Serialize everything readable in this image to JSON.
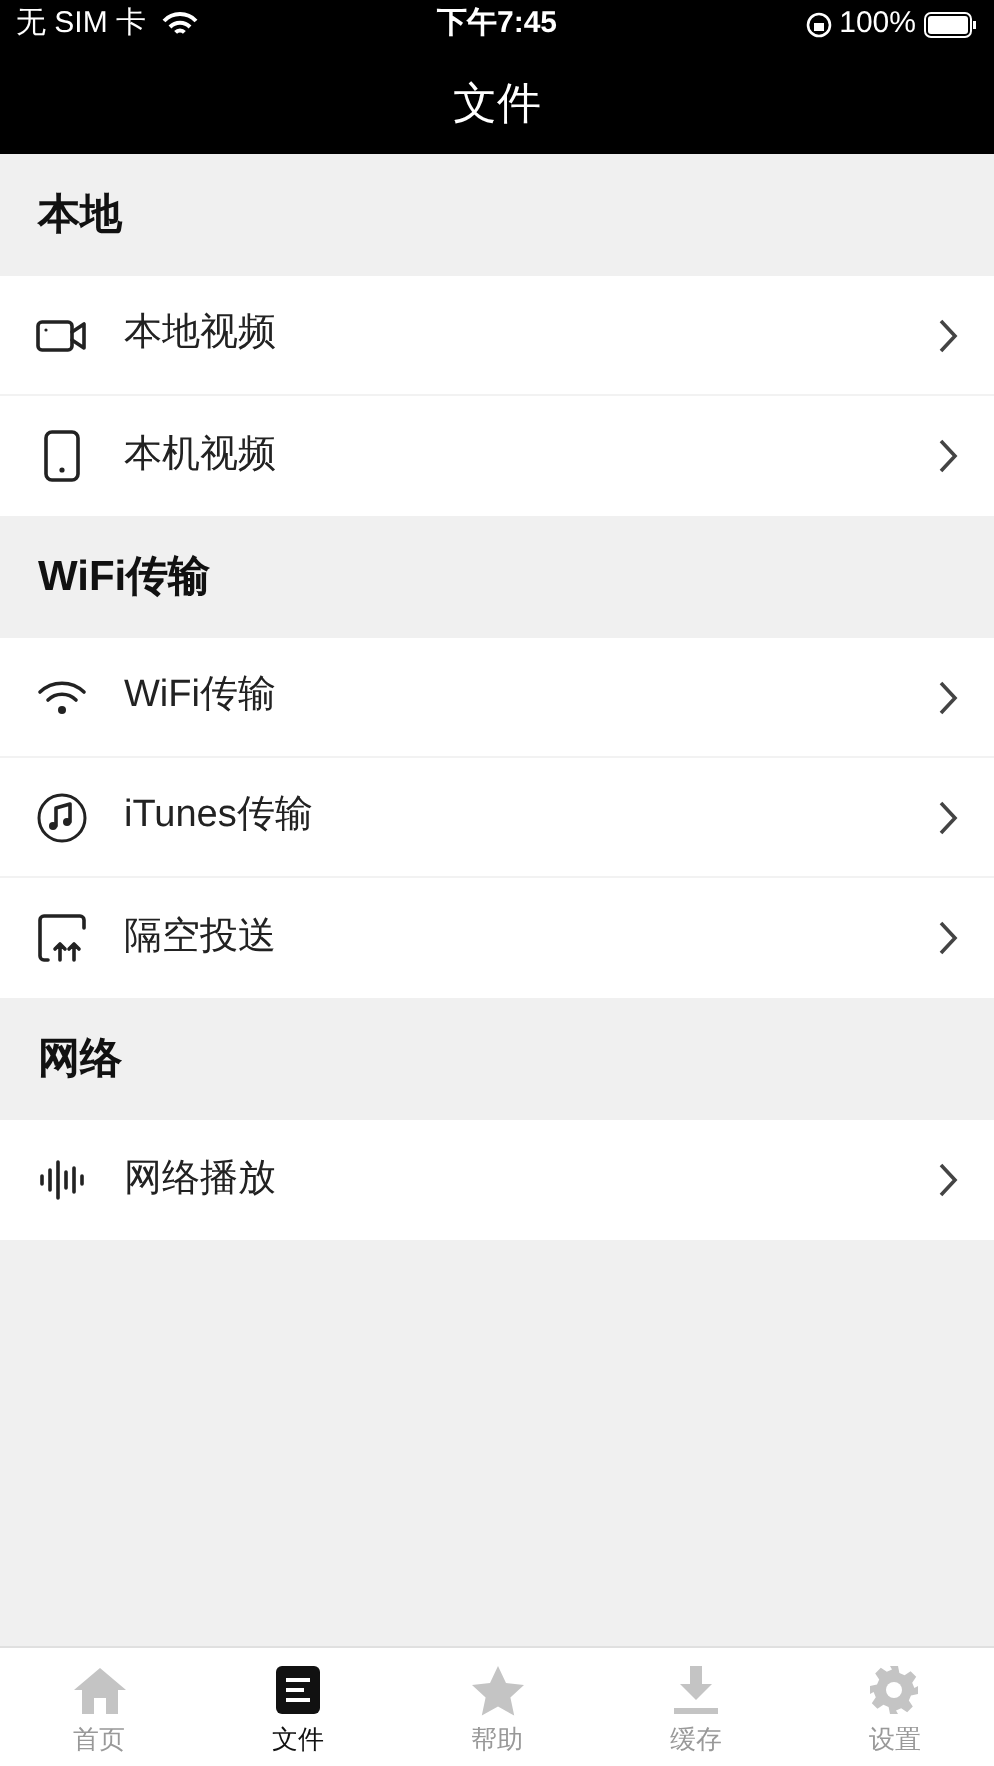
{
  "status_bar": {
    "carrier": "无 SIM 卡",
    "time": "下午7:45",
    "battery": "100%"
  },
  "nav_bar": {
    "title": "文件"
  },
  "sections": [
    {
      "title": "本地",
      "items": [
        {
          "label": "本地视频",
          "kind": "camera"
        },
        {
          "label": "本机视频",
          "kind": "phone"
        }
      ]
    },
    {
      "title": "WiFi传输",
      "items": [
        {
          "label": "WiFi传输",
          "kind": "wifi"
        },
        {
          "label": "iTunes传输",
          "kind": "music"
        },
        {
          "label": "隔空投送",
          "kind": "upload"
        }
      ]
    },
    {
      "title": "网络",
      "items": [
        {
          "label": "网络播放",
          "kind": "wave"
        }
      ]
    }
  ],
  "tab_bar": [
    {
      "label": "首页",
      "kind": "home",
      "selected": false
    },
    {
      "label": "文件",
      "kind": "file",
      "selected": true
    },
    {
      "label": "帮助",
      "kind": "star",
      "selected": false
    },
    {
      "label": "缓存",
      "kind": "download",
      "selected": false
    },
    {
      "label": "设置",
      "kind": "gear",
      "selected": false
    }
  ]
}
